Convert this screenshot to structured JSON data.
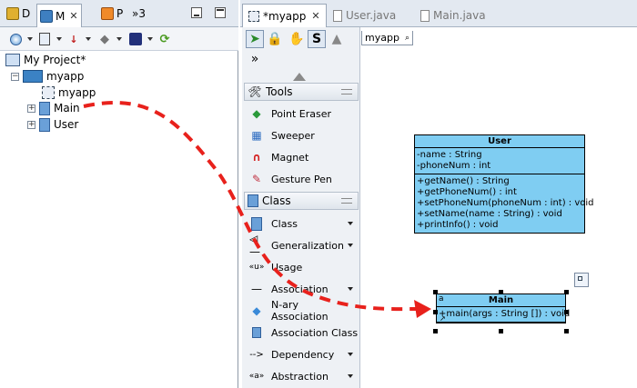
{
  "left_tabs": [
    {
      "label": "D",
      "icon": "diagram-navigator-icon"
    },
    {
      "label": "M",
      "icon": "model-explorer-icon",
      "active": true
    },
    {
      "label": "P",
      "icon": "property-icon"
    },
    {
      "label": "»3",
      "icon": "more-tabs-icon"
    }
  ],
  "tree": {
    "root": "My Project*",
    "project": "myapp",
    "diagram": "myapp",
    "classes": [
      "Main",
      "User"
    ]
  },
  "editor_tabs": [
    {
      "label": "*myapp",
      "active": true
    },
    {
      "label": "User.java"
    },
    {
      "label": "Main.java"
    }
  ],
  "diagram_tab_label": "myapp",
  "palette": {
    "tools_header": "Tools",
    "tools": [
      "Point Eraser",
      "Sweeper",
      "Magnet",
      "Gesture Pen"
    ],
    "class_header": "Class",
    "class_items": [
      "Class",
      "Generalization",
      "Usage",
      "Association",
      "N-ary Association",
      "Association Class",
      "Dependency",
      "Abstraction"
    ],
    "top_tools": [
      "select-arrow-icon",
      "lock-icon",
      "hand-icon",
      "sweeper-s-icon",
      "triangle-icon"
    ]
  },
  "uml": {
    "user": {
      "name": "User",
      "attributes": [
        "-name : String",
        "-phoneNum : int"
      ],
      "operations": [
        "+getName() : String",
        "+getPhoneNum() : int",
        "+setPhoneNum(phoneNum : int) : void",
        "+setName(name : String) : void",
        "+printInfo() : void"
      ]
    },
    "main": {
      "name": "Main",
      "operations": [
        "+main(args : String []) : void"
      ]
    }
  },
  "colors": {
    "uml_fill": "#7fcdf2",
    "drag_arrow": "#e8211c",
    "tab_bar": "#e3e9f1"
  }
}
